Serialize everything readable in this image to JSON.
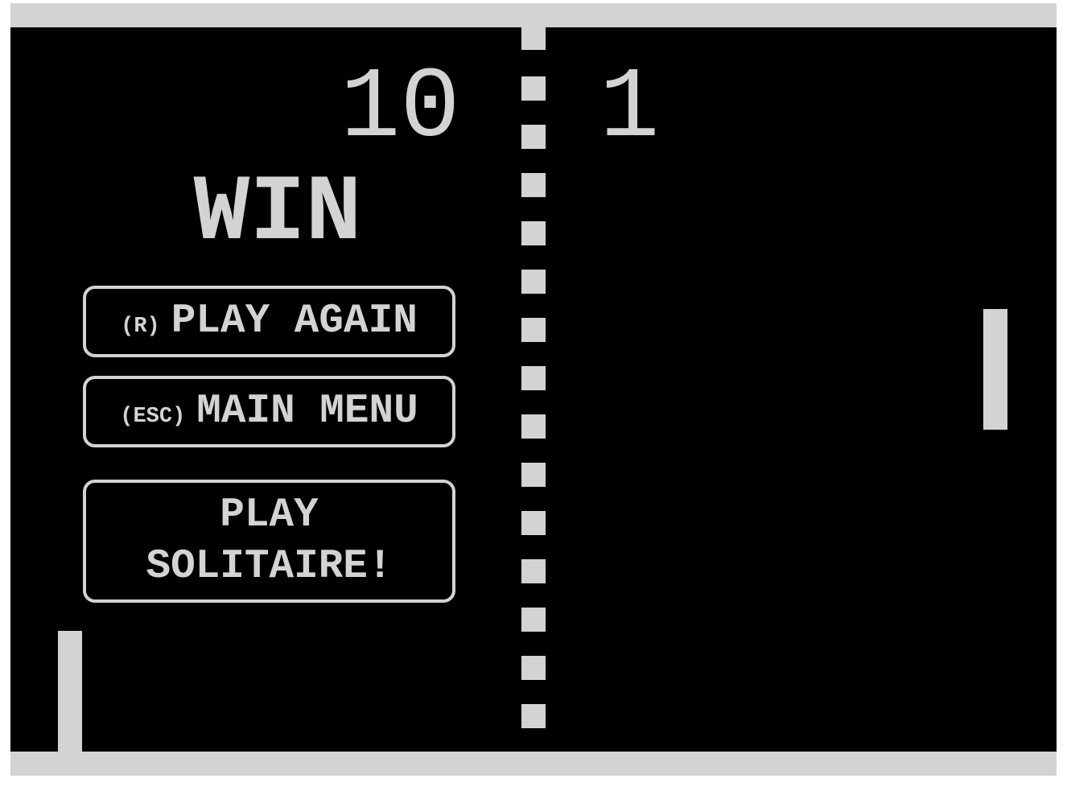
{
  "scores": {
    "left": "10",
    "right": "1"
  },
  "result_text": "WIN",
  "menu": [
    {
      "key": "(R)",
      "label": "PLAY AGAIN"
    },
    {
      "key": "(ESC)",
      "label": "MAIN MENU"
    },
    {
      "key": "",
      "label_line1": "PLAY",
      "label_line2": "SOLITAIRE!"
    }
  ],
  "colors": {
    "foreground": "#d3d3d3",
    "background": "#000000"
  }
}
